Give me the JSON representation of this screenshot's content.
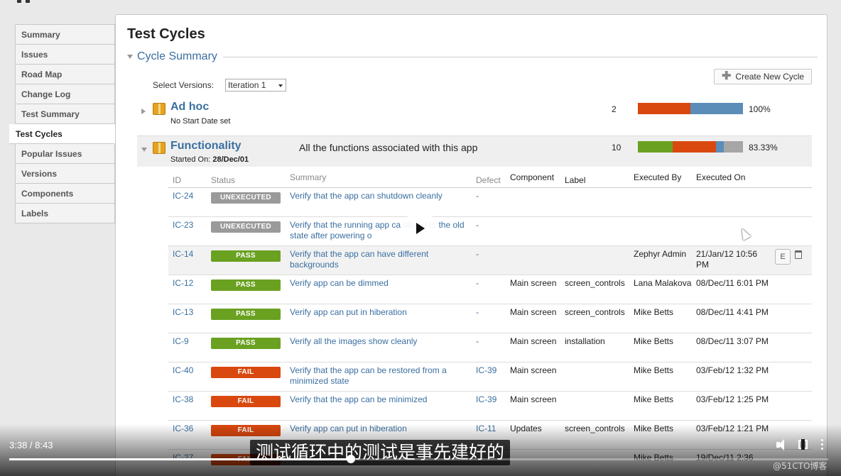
{
  "sidebar": {
    "items": [
      {
        "label": "Summary"
      },
      {
        "label": "Issues"
      },
      {
        "label": "Road Map"
      },
      {
        "label": "Change Log"
      },
      {
        "label": "Test Summary"
      },
      {
        "label": "Test Cycles",
        "active": true
      },
      {
        "label": "Popular Issues"
      },
      {
        "label": "Versions"
      },
      {
        "label": "Components"
      },
      {
        "label": "Labels"
      }
    ]
  },
  "page": {
    "title": "Test Cycles",
    "section_title": "Cycle Summary",
    "select_versions_label": "Select Versions:",
    "selected_version": "Iteration 1",
    "create_button": "Create New Cycle"
  },
  "cycles": [
    {
      "name": "Ad hoc",
      "sub_text": "No Start Date set",
      "description": "",
      "count": "2",
      "percent": "100%",
      "progress": [
        {
          "status": "fail",
          "share": 0.5,
          "color": "#d9480f"
        },
        {
          "status": "other",
          "share": 0.5,
          "color": "#5b8db8"
        }
      ]
    },
    {
      "name": "Functionality",
      "sub_label": "Started On:",
      "sub_value": "28/Dec/01",
      "description": "All the functions associated with this app",
      "count": "10",
      "percent": "83.33%",
      "progress": [
        {
          "status": "pass",
          "share": 0.33,
          "color": "#6aa121"
        },
        {
          "status": "fail",
          "share": 0.41,
          "color": "#d9480f"
        },
        {
          "status": "other",
          "share": 0.08,
          "color": "#5b8db8"
        },
        {
          "status": "unexecuted",
          "share": 0.18,
          "color": "#a6a6a6"
        }
      ]
    }
  ],
  "table": {
    "headers": {
      "id": "ID",
      "status": "Status",
      "summary": "Summary",
      "defect": "Defect",
      "component": "Component",
      "label": "Label",
      "executed_by": "Executed By",
      "executed_on": "Executed On"
    },
    "status_colors": {
      "UNEXECUTED": "#9a9a9a",
      "PASS": "#6aa121",
      "FAIL": "#d9480f"
    },
    "rows": [
      {
        "id": "IC-24",
        "status": "UNEXECUTED",
        "summary": "Verify that the app can shutdown cleanly",
        "defect": "-",
        "component": "",
        "label": "",
        "executed_by": "",
        "executed_on": ""
      },
      {
        "id": "IC-23",
        "status": "UNEXECUTED",
        "summary": "Verify that the running app ca      stored to the old state after powering o",
        "defect": "-",
        "component": "",
        "label": "",
        "executed_by": "",
        "executed_on": ""
      },
      {
        "id": "IC-14",
        "status": "PASS",
        "summary": "Verify that the app can have different backgrounds",
        "defect": "-",
        "component": "",
        "label": "",
        "executed_by": "Zephyr Admin",
        "executed_on": "21/Jan/12 10:56 PM",
        "highlight": true,
        "edit_label": "E"
      },
      {
        "id": "IC-12",
        "status": "PASS",
        "summary": "Verify app can be dimmed",
        "defect": "-",
        "component": "Main screen",
        "label": "screen_controls",
        "executed_by": "Lana Malakova",
        "executed_on": "08/Dec/11 6:01 PM"
      },
      {
        "id": "IC-13",
        "status": "PASS",
        "summary": "Verify app can put in hiberation",
        "defect": "-",
        "component": "Main screen",
        "label": "screen_controls",
        "executed_by": "Mike Betts",
        "executed_on": "08/Dec/11 4:41 PM"
      },
      {
        "id": "IC-9",
        "status": "PASS",
        "summary": "Verify all the images show cleanly",
        "defect": "-",
        "component": "Main screen",
        "label": "installation",
        "executed_by": "Mike Betts",
        "executed_on": "08/Dec/11 3:07 PM"
      },
      {
        "id": "IC-40",
        "status": "FAIL",
        "summary": "Verify that the app can be restored from a minimized state",
        "defect": "IC-39",
        "component": "Main screen",
        "label": "",
        "executed_by": "Mike Betts",
        "executed_on": "03/Feb/12 1:32 PM"
      },
      {
        "id": "IC-38",
        "status": "FAIL",
        "summary": "Verify that the app can be minimized",
        "defect": "IC-39",
        "component": "Main screen",
        "label": "",
        "executed_by": "Mike Betts",
        "executed_on": "03/Feb/12 1:25 PM"
      },
      {
        "id": "IC-36",
        "status": "FAIL",
        "summary": "Verify app can put in hiberation",
        "defect": "IC-11",
        "component": "Updates",
        "label": "screen_controls",
        "executed_by": "Mike Betts",
        "executed_on": "03/Feb/12 1:21 PM"
      },
      {
        "id": "IC-27",
        "status": "FAIL",
        "summary": "",
        "defect": "",
        "component": "",
        "label": "",
        "executed_by": "Mike Betts",
        "executed_on": "19/Dec/11 2:36"
      }
    ]
  },
  "video": {
    "time": "3:38 / 8:43",
    "progress": 0.4175,
    "subtitle": "测试循环中的测试是事先建好的",
    "watermark": "@51CTO博客"
  }
}
